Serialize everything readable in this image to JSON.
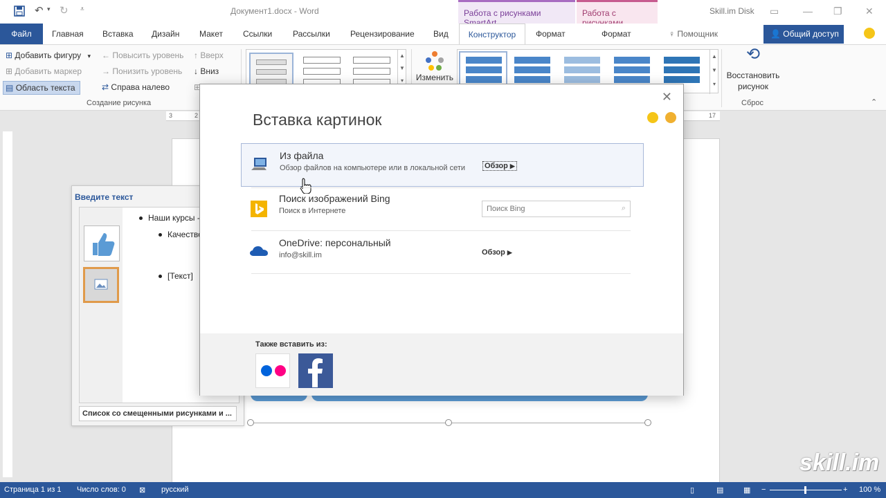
{
  "titlebar": {
    "doc_title": "Документ1.docx - Word",
    "ctx_smartart": "Работа с рисунками SmartArt",
    "ctx_pictures": "Работа с рисунками",
    "skilldisk": "Skill.im Disk"
  },
  "tabs": {
    "file": "Файл",
    "home": "Главная",
    "insert": "Вставка",
    "design": "Дизайн",
    "layout": "Макет",
    "references": "Ссылки",
    "mailings": "Рассылки",
    "review": "Рецензирование",
    "view": "Вид",
    "constructor": "Конструктор",
    "format1": "Формат",
    "format2": "Формат",
    "helper": "Помощник",
    "share": "Общий доступ"
  },
  "ribbon": {
    "add_shape": "Добавить фигуру",
    "add_bullet": "Добавить маркер",
    "text_pane": "Область текста",
    "promote": "Повысить уровень",
    "demote": "Понизить уровень",
    "rtl": "Справа налево",
    "up": "Вверх",
    "down": "Вниз",
    "group_create": "Создание рисунка",
    "change_colors": "Изменить",
    "reset_line1": "Восстановить",
    "reset_line2": "рисунок",
    "group_reset": "Сброс"
  },
  "ruler": {
    "marks": [
      "3",
      "2",
      "17"
    ]
  },
  "textpane": {
    "title": "Введите текст",
    "item1": "Наши курсы -",
    "item2": "Качество",
    "item3": "[Текст]",
    "footer": "Список со смещенными рисунками и ..."
  },
  "dialog": {
    "title": "Вставка картинок",
    "from_file_title": "Из файла",
    "from_file_sub": "Обзор файлов на компьютере или в локальной сети",
    "from_file_action": "Обзор",
    "bing_title": "Поиск изображений Bing",
    "bing_sub": "Поиск в Интернете",
    "bing_placeholder": "Поиск Bing",
    "onedrive_title": "OneDrive: персональный",
    "onedrive_sub": "info@skill.im",
    "onedrive_action": "Обзор",
    "also_insert": "Также вставить из:"
  },
  "statusbar": {
    "page": "Страница 1 из 1",
    "words": "Число слов: 0",
    "lang": "русский",
    "zoom": "100 %"
  },
  "watermark": "skill.im",
  "colors": {
    "brand": "#2b579a",
    "smartart_blue": "#5b9bd5",
    "facebook": "#3b5998",
    "bing": "#f4b400"
  }
}
